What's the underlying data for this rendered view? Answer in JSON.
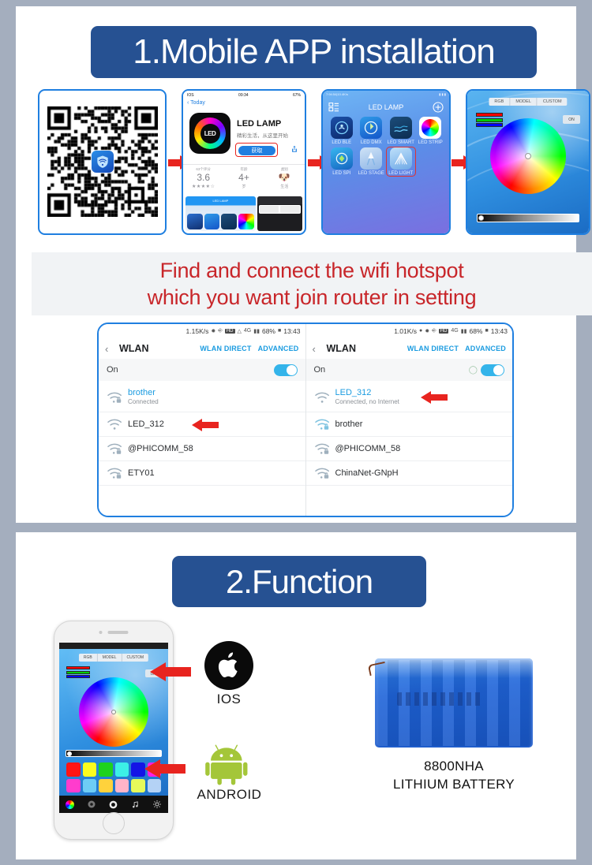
{
  "page": {
    "bg_color": "#a4aebe",
    "panel_color": "#ffffff",
    "accent_blue": "#265192",
    "accent_red": "#c8262a"
  },
  "section1": {
    "heading": "1.Mobile APP installation",
    "steps": {
      "qr": {
        "name": "QR code",
        "logo": "wifi-shield-icon"
      },
      "appstore": {
        "status_left": "IOS",
        "status_time": "09:34",
        "status_right": "67%",
        "nav_back": "Today",
        "app_name": "LED LAMP",
        "app_subtitle": "精彩生活，从这里开始",
        "get_button": "获取",
        "stats": [
          {
            "caption": "63个评分",
            "value": "3.6",
            "sub": "★★★★☆"
          },
          {
            "caption": "年龄",
            "value": "4+",
            "sub": "岁"
          },
          {
            "caption": "类别",
            "value": "",
            "sub": "生活"
          }
        ],
        "preview_title": "LED LAMP",
        "icon_label": "LED"
      },
      "appgrid": {
        "status_left": "7:94:54|10.4K/s",
        "title": "LED LAMP",
        "add_icon": "plus-circle-icon",
        "menu_icon": "list-icon",
        "apps": [
          {
            "label": "LED BLE",
            "style": "sq-ble"
          },
          {
            "label": "LED DMX",
            "style": "sq-dmx"
          },
          {
            "label": "LED SMART",
            "style": "sq-smart"
          },
          {
            "label": "LED STRIP",
            "style": "sq-strip"
          },
          {
            "label": "LED SPI",
            "style": "sq-spi"
          },
          {
            "label": "LED STAGE",
            "style": "sq-stage"
          },
          {
            "label": "LED LIGHT",
            "style": "sq-light",
            "highlighted": true
          }
        ]
      },
      "colorwheel": {
        "tabs": [
          "RGB",
          "MODEL",
          "CUSTOM"
        ],
        "on_button": "ON",
        "rgb_bars": [
          "#ff0000",
          "#00cc00",
          "#0000ff"
        ]
      }
    },
    "wifi_banner": {
      "line1": "Find and connect the wifi hotspot",
      "line2": "which you want join router in setting"
    },
    "wlan_left": {
      "status": {
        "speed": "1.15K/s",
        "hd": "HD",
        "network": "4G",
        "battery": "68%",
        "time": "13:43"
      },
      "back_icon": "chevron-left-icon",
      "title": "WLAN",
      "action1": "WLAN DIRECT",
      "action2": "ADVANCED",
      "toggle_label": "On",
      "toggle_on": true,
      "networks": [
        {
          "name": "brother",
          "status": "Connected",
          "locked": true,
          "blue": true
        },
        {
          "name": "LED_312",
          "status": "",
          "locked": false,
          "blue": false,
          "arrow": true
        },
        {
          "name": "@PHICOMM_58",
          "status": "",
          "locked": true,
          "blue": false
        },
        {
          "name": "ETY01",
          "status": "",
          "locked": true,
          "blue": false
        }
      ]
    },
    "wlan_right": {
      "status": {
        "speed": "1.01K/s",
        "hd": "HD",
        "network": "4G",
        "battery": "68%",
        "time": "13:43"
      },
      "back_icon": "chevron-left-icon",
      "title": "WLAN",
      "action1": "WLAN DIRECT",
      "action2": "ADVANCED",
      "toggle_label": "On",
      "toggle_on": true,
      "networks": [
        {
          "name": "LED_312",
          "status": "Connected, no Internet",
          "locked": false,
          "blue": true,
          "arrow": true
        },
        {
          "name": "brother",
          "status": "",
          "locked": true,
          "blue": false
        },
        {
          "name": "@PHICOMM_58",
          "status": "",
          "locked": true,
          "blue": false
        },
        {
          "name": "ChinaNet-GNpH",
          "status": "",
          "locked": true,
          "blue": false
        }
      ]
    }
  },
  "section2": {
    "heading": "2.Function",
    "phone": {
      "tabs": [
        "RGB",
        "MODEL",
        "CUSTOM"
      ],
      "on_button": "ON",
      "swatches_row1": [
        "#ff1414",
        "#fcfc1e",
        "#1ed21e",
        "#3cf0e6",
        "#1414e6",
        "#ff1ee6"
      ],
      "swatches_row2": [
        "#ff3ccd",
        "#6ecdf5",
        "#ffd23c",
        "#ffb4c8",
        "#e6fa5a",
        "#b4d2f5"
      ],
      "toolbar_icons": [
        "color-wheel-icon",
        "record-icon",
        "circle-icon",
        "music-note-icon",
        "gear-icon"
      ]
    },
    "ios": {
      "label": "IOS",
      "icon": "apple-icon"
    },
    "android": {
      "label": "ANDROID",
      "icon": "android-icon"
    },
    "battery": {
      "line1": "8800NHA",
      "line2": "LITHIUM BATTERY"
    }
  }
}
